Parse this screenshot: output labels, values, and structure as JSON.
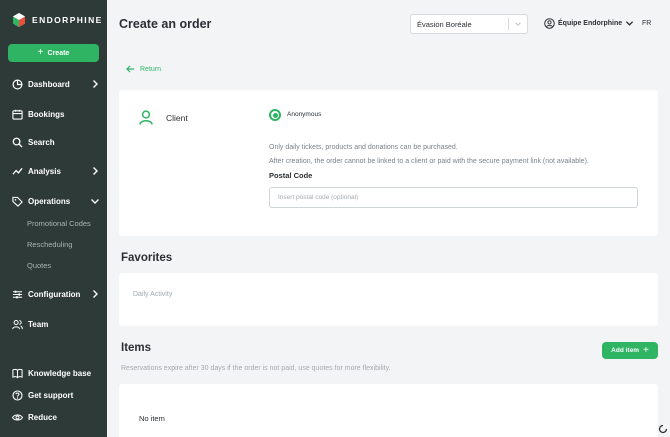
{
  "app": {
    "brand": "ENDORPHINE",
    "brand_colors": {
      "primary": "#2fb463",
      "sidebar": "#2e3a38"
    }
  },
  "sidebar": {
    "create_label": "Create",
    "items": [
      {
        "label": "Dashboard",
        "icon": "pie-chart-icon",
        "has_chevron": true
      },
      {
        "label": "Bookings",
        "icon": "calendar-icon",
        "has_chevron": false
      },
      {
        "label": "Search",
        "icon": "search-icon",
        "has_chevron": false
      },
      {
        "label": "Analysis",
        "icon": "line-chart-icon",
        "has_chevron": true
      },
      {
        "label": "Operations",
        "icon": "tag-icon",
        "has_chevron": true,
        "expanded": true
      },
      {
        "label": "Configuration",
        "icon": "sliders-icon",
        "has_chevron": true
      },
      {
        "label": "Team",
        "icon": "users-icon",
        "has_chevron": false
      }
    ],
    "operations_subitems": [
      "Promotional Codes",
      "Rescheduling",
      "Quotes"
    ],
    "bottom": [
      {
        "label": "Knowledge base",
        "icon": "book-icon"
      },
      {
        "label": "Get support",
        "icon": "help-circle-icon"
      },
      {
        "label": "Reduce",
        "icon": "eye-icon"
      }
    ]
  },
  "header": {
    "title": "Create an order",
    "org_select_value": "Évasion Boréale",
    "team_label": "Équipe Endorphine",
    "language": "FR"
  },
  "return_label": "Return",
  "client": {
    "label": "Client",
    "anonymous_label": "Anonymous",
    "anonymous_selected": true,
    "note_line1": "Only daily tickets, products and donations can be purchased.",
    "note_line2": "After creation, the order cannot be linked to a client or paid with the secure payment link (not available).",
    "postal_code_label": "Postal Code",
    "postal_code_value": "",
    "postal_code_placeholder": "Insert postal code (optional)"
  },
  "favorites": {
    "title": "Favorites",
    "items": [
      "Daily Activity"
    ]
  },
  "items": {
    "title": "Items",
    "add_label": "Add item",
    "note": "Reservations expire after 30 days if the order is not paid, use quotes for more flexibility.",
    "empty_label": "No item"
  }
}
